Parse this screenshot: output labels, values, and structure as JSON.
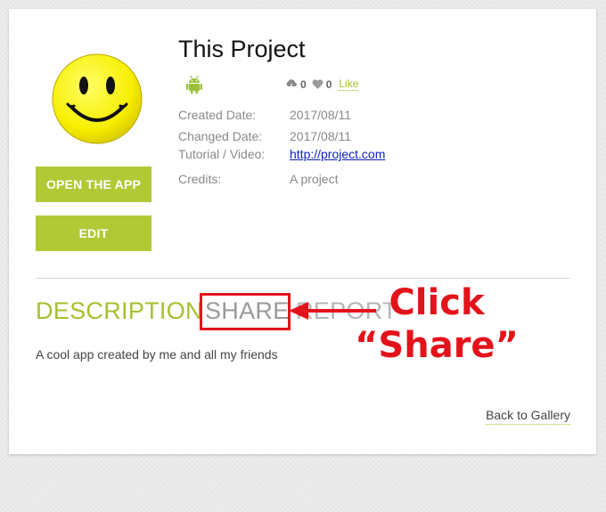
{
  "project": {
    "title": "This Project",
    "platform_icon": "android-icon",
    "downloads": "0",
    "likes": "0",
    "like_label": "Like"
  },
  "buttons": {
    "open_app": "OPEN THE APP",
    "edit": "EDIT"
  },
  "meta": [
    {
      "label": "Created Date:",
      "value": "2017/08/11"
    },
    {
      "label": "Changed Date:",
      "value": "2017/08/11"
    },
    {
      "label": "Tutorial / Video:",
      "value": "http://project.com"
    },
    {
      "label": "Credits:",
      "value": "A project"
    }
  ],
  "tabs": {
    "description": "DESCRIPTION",
    "share": "SHARE",
    "report": "REPORT"
  },
  "description_text": "A cool app created by me and all my friends",
  "back_link": "Back to Gallery",
  "annotation": {
    "line1": "Click",
    "line2": "“Share”"
  },
  "colors": {
    "accent": "#b2c936",
    "annotation_red": "#e3131b",
    "link_blue": "#0b1fbf"
  }
}
